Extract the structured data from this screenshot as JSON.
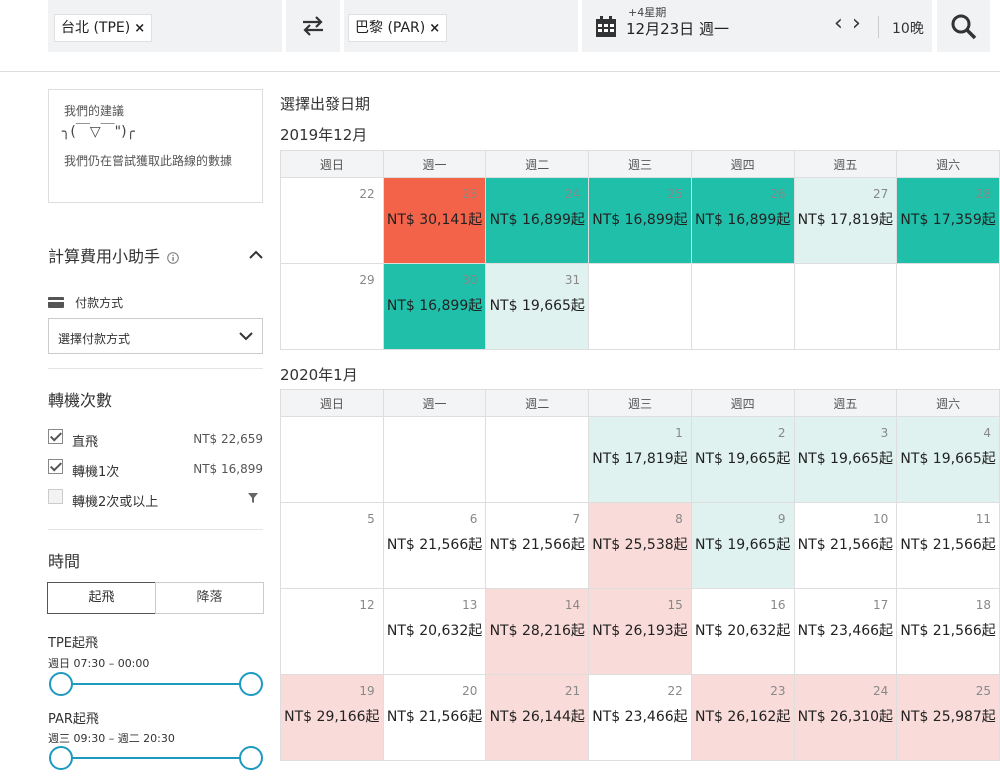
{
  "header": {
    "origin": "台北 (TPE)",
    "destination": "巴黎 (PAR)",
    "date_note": "+4星期",
    "date": "12月23日 週一",
    "nights": "10晚",
    "prev": "‹",
    "next": "›",
    "remove": "×"
  },
  "suggest": {
    "title": "我們的建議",
    "face": "╮(￣▽￣\")╭",
    "message": "我們仍在嘗試獲取此路線的數據"
  },
  "calc": {
    "title": "計算費用小助手",
    "payment_label": "付款方式",
    "payment_select": "選擇付款方式"
  },
  "stops": {
    "title": "轉機次數",
    "items": [
      {
        "label": "直飛",
        "price": "NT$ 22,659",
        "checked": true
      },
      {
        "label": "轉機1次",
        "price": "NT$ 16,899",
        "checked": true
      },
      {
        "label": "轉機2次或以上",
        "price": "",
        "checked": false
      }
    ]
  },
  "time": {
    "title": "時間",
    "tab_depart": "起飛",
    "tab_arrive": "降落",
    "tpe_label": "TPE起飛",
    "tpe_range": "週日 07:30 – 00:00",
    "par_label": "PAR起飛",
    "par_range": "週三 09:30 – 週二 20:30"
  },
  "calendar": {
    "heading": "選擇出發日期",
    "weekdays": [
      "週日",
      "週一",
      "週二",
      "週三",
      "週四",
      "週五",
      "週六"
    ],
    "months": [
      {
        "title": "2019年12月",
        "weeks": [
          [
            {
              "day": "22",
              "price": "",
              "color": "none"
            },
            {
              "day": "23",
              "price": "NT$ 30,141起",
              "color": "red"
            },
            {
              "day": "24",
              "price": "NT$ 16,899起",
              "color": "teal"
            },
            {
              "day": "25",
              "price": "NT$ 16,899起",
              "color": "teal"
            },
            {
              "day": "26",
              "price": "NT$ 16,899起",
              "color": "teal"
            },
            {
              "day": "27",
              "price": "NT$ 17,819起",
              "color": "lteal"
            },
            {
              "day": "28",
              "price": "NT$ 17,359起",
              "color": "teal"
            }
          ],
          [
            {
              "day": "29",
              "price": "",
              "color": "none"
            },
            {
              "day": "30",
              "price": "NT$ 16,899起",
              "color": "teal"
            },
            {
              "day": "31",
              "price": "NT$ 19,665起",
              "color": "lteal"
            },
            {
              "day": "",
              "price": "",
              "color": "none"
            },
            {
              "day": "",
              "price": "",
              "color": "none"
            },
            {
              "day": "",
              "price": "",
              "color": "none"
            },
            {
              "day": "",
              "price": "",
              "color": "none"
            }
          ]
        ]
      },
      {
        "title": "2020年1月",
        "weeks": [
          [
            {
              "day": "",
              "price": "",
              "color": "none"
            },
            {
              "day": "",
              "price": "",
              "color": "none"
            },
            {
              "day": "",
              "price": "",
              "color": "none"
            },
            {
              "day": "1",
              "price": "NT$ 17,819起",
              "color": "lteal"
            },
            {
              "day": "2",
              "price": "NT$ 19,665起",
              "color": "lteal"
            },
            {
              "day": "3",
              "price": "NT$ 19,665起",
              "color": "lteal"
            },
            {
              "day": "4",
              "price": "NT$ 19,665起",
              "color": "lteal"
            }
          ],
          [
            {
              "day": "5",
              "price": "",
              "color": "none"
            },
            {
              "day": "6",
              "price": "NT$ 21,566起",
              "color": "none"
            },
            {
              "day": "7",
              "price": "NT$ 21,566起",
              "color": "none"
            },
            {
              "day": "8",
              "price": "NT$ 25,538起",
              "color": "pink"
            },
            {
              "day": "9",
              "price": "NT$ 19,665起",
              "color": "lteal"
            },
            {
              "day": "10",
              "price": "NT$ 21,566起",
              "color": "none"
            },
            {
              "day": "11",
              "price": "NT$ 21,566起",
              "color": "none"
            }
          ],
          [
            {
              "day": "12",
              "price": "",
              "color": "none"
            },
            {
              "day": "13",
              "price": "NT$ 20,632起",
              "color": "none"
            },
            {
              "day": "14",
              "price": "NT$ 28,216起",
              "color": "pink"
            },
            {
              "day": "15",
              "price": "NT$ 26,193起",
              "color": "pink"
            },
            {
              "day": "16",
              "price": "NT$ 20,632起",
              "color": "none"
            },
            {
              "day": "17",
              "price": "NT$ 23,466起",
              "color": "none"
            },
            {
              "day": "18",
              "price": "NT$ 21,566起",
              "color": "none"
            }
          ],
          [
            {
              "day": "19",
              "price": "NT$ 29,166起",
              "color": "pink"
            },
            {
              "day": "20",
              "price": "NT$ 21,566起",
              "color": "none"
            },
            {
              "day": "21",
              "price": "NT$ 26,144起",
              "color": "pink"
            },
            {
              "day": "22",
              "price": "NT$ 23,466起",
              "color": "none"
            },
            {
              "day": "23",
              "price": "NT$ 26,162起",
              "color": "pink"
            },
            {
              "day": "24",
              "price": "NT$ 26,310起",
              "color": "pink"
            },
            {
              "day": "25",
              "price": "NT$ 25,987起",
              "color": "pink"
            }
          ]
        ]
      }
    ]
  },
  "colors": {
    "cheap": "#20bfa9",
    "low": "#dff2ef",
    "high": "#f9dcd9",
    "highest": "#f3634a",
    "slider": "#1e9ac0"
  },
  "icons": {
    "swap": "swap-icon",
    "calendar": "calendar-icon",
    "search": "search-icon",
    "info": "info-icon",
    "collapse": "chevron-up-icon",
    "card": "credit-card-icon",
    "dropdown": "chevron-down-icon",
    "filter": "filter-icon"
  }
}
